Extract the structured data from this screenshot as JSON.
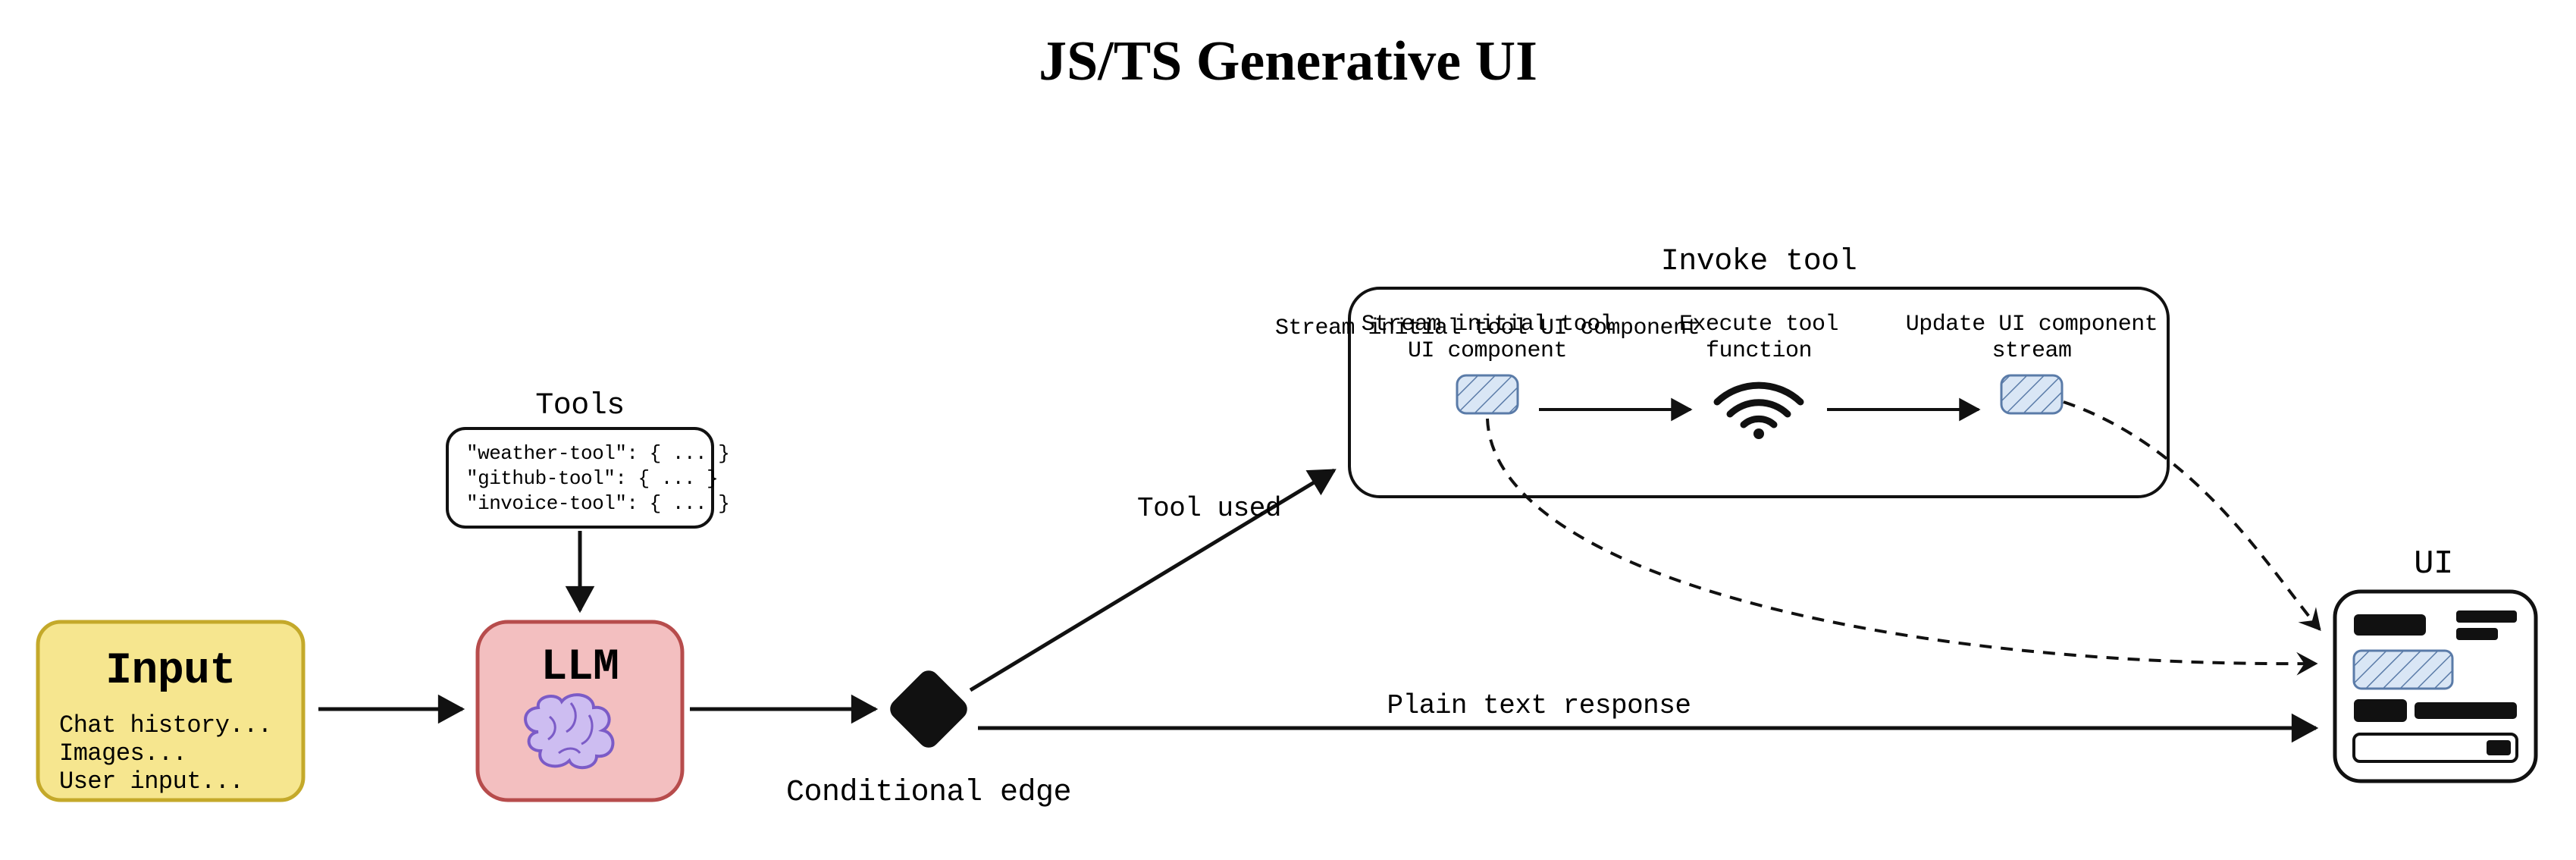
{
  "title": "JS/TS Generative UI",
  "input": {
    "heading": "Input",
    "lines": [
      "Chat history...",
      "Images...",
      "User input..."
    ],
    "fill": "#f6e68f",
    "stroke": "#c4a92a"
  },
  "llm": {
    "heading": "LLM",
    "fill": "#f3bfc0",
    "stroke": "#b74c4c"
  },
  "tools": {
    "label": "Tools",
    "lines": [
      "\"weather-tool\": { ... }",
      "\"github-tool\": { ... }",
      "\"invoice-tool\": { ... }"
    ]
  },
  "conditional": {
    "label": "Conditional edge"
  },
  "tool_branch": {
    "edge_label": "Tool used",
    "group_label": "Invoke tool",
    "steps": [
      "Stream initial tool UI component",
      "Execute tool function",
      "Update UI component stream"
    ]
  },
  "plain_branch": {
    "label": "Plain text response"
  },
  "ui": {
    "label": "UI"
  },
  "colors": {
    "hatch_fill": "#d9e6f5",
    "hatch_stroke": "#5a7ba8",
    "black": "#111111"
  }
}
